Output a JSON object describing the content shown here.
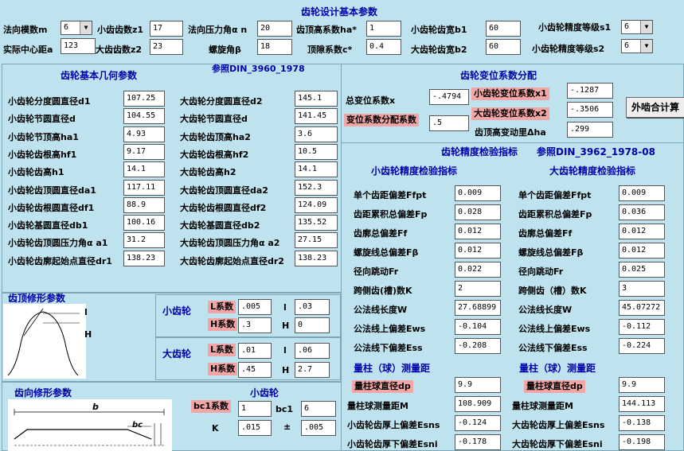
{
  "top": {
    "title": "齿轮设计基本参数",
    "mn_label": "法向模数m",
    "mn_value": "6",
    "z1_label": "小齿齿数z1",
    "z1_value": "17",
    "alpha_label": "法向压力角α n",
    "alpha_value": "20",
    "ha_label": "齿顶高系数ha*",
    "ha_value": "1",
    "b1_label": "小齿轮齿宽b1",
    "b1_value": "60",
    "s1_label": "小齿轮精度等级s1",
    "s1_value": "6",
    "a_label": "实际中心距a",
    "a_value": "123",
    "z2_label": "大齿齿数z2",
    "z2_value": "23",
    "beta_label": "螺旋角β",
    "beta_value": "18",
    "c_label": "顶隙系数c*",
    "c_value": "0.4",
    "b2_label": "大齿轮齿宽b2",
    "b2_value": "60",
    "s2_label": "小齿轮精度等级s2",
    "s2_value": "6"
  },
  "geometry": {
    "title": "齿轮基本几何参数",
    "ref": "参照DIN_3960_1978",
    "left": [
      {
        "label": "小齿轮分度圆直径d1",
        "value": "107.25"
      },
      {
        "label": "小齿轮节圆直径d",
        "value": "104.55"
      },
      {
        "label": "小齿轮节顶高ha1",
        "value": "4.93"
      },
      {
        "label": "小齿轮齿根高hf1",
        "value": "9.17"
      },
      {
        "label": "小齿轮齿高h1",
        "value": "14.1"
      },
      {
        "label": "小齿轮齿顶圆直径da1",
        "value": "117.11"
      },
      {
        "label": "小齿轮齿根圆直径df1",
        "value": "88.9"
      },
      {
        "label": "小齿轮基圆直径db1",
        "value": "100.16"
      },
      {
        "label": "小齿轮齿顶圆压力角α a1",
        "value": "31.2"
      },
      {
        "label": "小齿轮齿廓起始点直径dr1",
        "value": "138.23"
      }
    ],
    "right": [
      {
        "label": "大齿轮分度圆直径d2",
        "value": "145.1"
      },
      {
        "label": "大齿轮节圆直径d",
        "value": "141.45"
      },
      {
        "label": "大齿轮齿顶高ha2",
        "value": "3.6"
      },
      {
        "label": "大齿轮齿根高hf2",
        "value": "10.5"
      },
      {
        "label": "大齿轮齿高h2",
        "value": "14.1"
      },
      {
        "label": "大齿轮齿顶圆直径da2",
        "value": "152.3"
      },
      {
        "label": "大齿轮齿根圆直径df2",
        "value": "124.09"
      },
      {
        "label": "大齿轮基圆直径db2",
        "value": "135.52"
      },
      {
        "label": "大齿轮齿顶圆压力角α a2",
        "value": "27.15"
      },
      {
        "label": "大齿轮齿廓起始点直径dr2",
        "value": "138.23"
      }
    ]
  },
  "shift": {
    "title": "齿轮变位系数分配",
    "total_label": "总变位系数x",
    "total_value": "-.4794",
    "dist_label": "变位系数分配系数",
    "dist_value": ".5",
    "x1_label": "小齿轮变位系数x1",
    "x1_value": "-.1287",
    "x2_label": "大齿轮变位系数x2",
    "x2_value": "-.3506",
    "dha_label": "齿顶高变动里Δha",
    "dha_value": ".299",
    "calc_button": "外啮合计算"
  },
  "accuracy": {
    "title": "齿轮精度检验指标",
    "ref": "参照DIN_3962_1978-08",
    "small_title": "小齿轮精度检验指标",
    "large_title": "大齿轮精度检验指标",
    "small": [
      {
        "label": "单个齿距偏差Ffpt",
        "value": "0.009"
      },
      {
        "label": "齿距累积总偏差Fp",
        "value": "0.028"
      },
      {
        "label": "齿廓总偏差Ff",
        "value": "0.012"
      },
      {
        "label": "螺旋线总偏差Fβ",
        "value": "0.012"
      },
      {
        "label": "径向跳动Fr",
        "value": "0.022"
      },
      {
        "label": "跨侧齿(槽)数K",
        "value": "2"
      },
      {
        "label": "公法线长度W",
        "value": "27.68899"
      },
      {
        "label": "公法线上偏差Ews",
        "value": "-0.104"
      },
      {
        "label": "公法线下偏差Ess",
        "value": "-0.208"
      }
    ],
    "large": [
      {
        "label": "单个齿距偏差Ffpt",
        "value": "0.009"
      },
      {
        "label": "齿距累积总偏差Fp",
        "value": "0.036"
      },
      {
        "label": "齿廓总偏差Ff",
        "value": "0.012"
      },
      {
        "label": "螺旋线总偏差Fβ",
        "value": "0.012"
      },
      {
        "label": "径向跳动Fr",
        "value": "0.025"
      },
      {
        "label": "跨侧齿（槽）数K",
        "value": "3"
      },
      {
        "label": "公法线长度W",
        "value": "45.07272"
      },
      {
        "label": "公法线上偏差Ews",
        "value": "-0.112"
      },
      {
        "label": "公法线下偏差Ess",
        "value": "-0.224"
      }
    ],
    "ball_title_small": "量柱（球）测量距",
    "ball_title_large": "量柱（球）测量距",
    "small_ball": [
      {
        "label": "量柱球直径dp",
        "value": "9.9"
      },
      {
        "label": "量柱球测量距M",
        "value": "108.909"
      },
      {
        "label": "小齿轮齿厚上偏差Esns",
        "value": "-0.124"
      },
      {
        "label": "小齿轮齿厚下偏差Esni",
        "value": "-0.178"
      }
    ],
    "large_ball": [
      {
        "label": "量柱球直径dp",
        "value": "9.9"
      },
      {
        "label": "量柱球测量距M",
        "value": "144.113"
      },
      {
        "label": "大齿轮齿厚上偏差Esns",
        "value": "-0.138"
      },
      {
        "label": "大齿轮齿厚下偏差Esni",
        "value": "-0.198"
      }
    ]
  },
  "tip_mod": {
    "title": "齿顶修形参数",
    "fig_l": "l",
    "fig_h": "H",
    "small_label": "小齿轮",
    "small_L_label": "L系数",
    "small_L_value": ".005",
    "small_l_label": "l",
    "small_l_value": ".03",
    "small_H_label": "H系数",
    "small_H_value": ".3",
    "small_H2_label": "H",
    "small_H2_value": "0",
    "large_label": "大齿轮",
    "large_L_label": "L系数",
    "large_L_value": ".01",
    "large_l_label": "l",
    "large_l_value": ".06",
    "large_H_label": "H系数",
    "large_H_value": ".45",
    "large_H2_label": "H",
    "large_H2_value": "2.7"
  },
  "lead_mod": {
    "title": "齿向修形参数",
    "fig_b": "b",
    "fig_bc": "bc",
    "small_label": "小齿轮",
    "bc1c_label": "bc1系数",
    "bc1c_value": "1",
    "bc1_label": "bc1",
    "bc1_value": "6",
    "k_label": "K",
    "k_value": ".015",
    "pm_label": "±",
    "pm_value": ".005"
  }
}
